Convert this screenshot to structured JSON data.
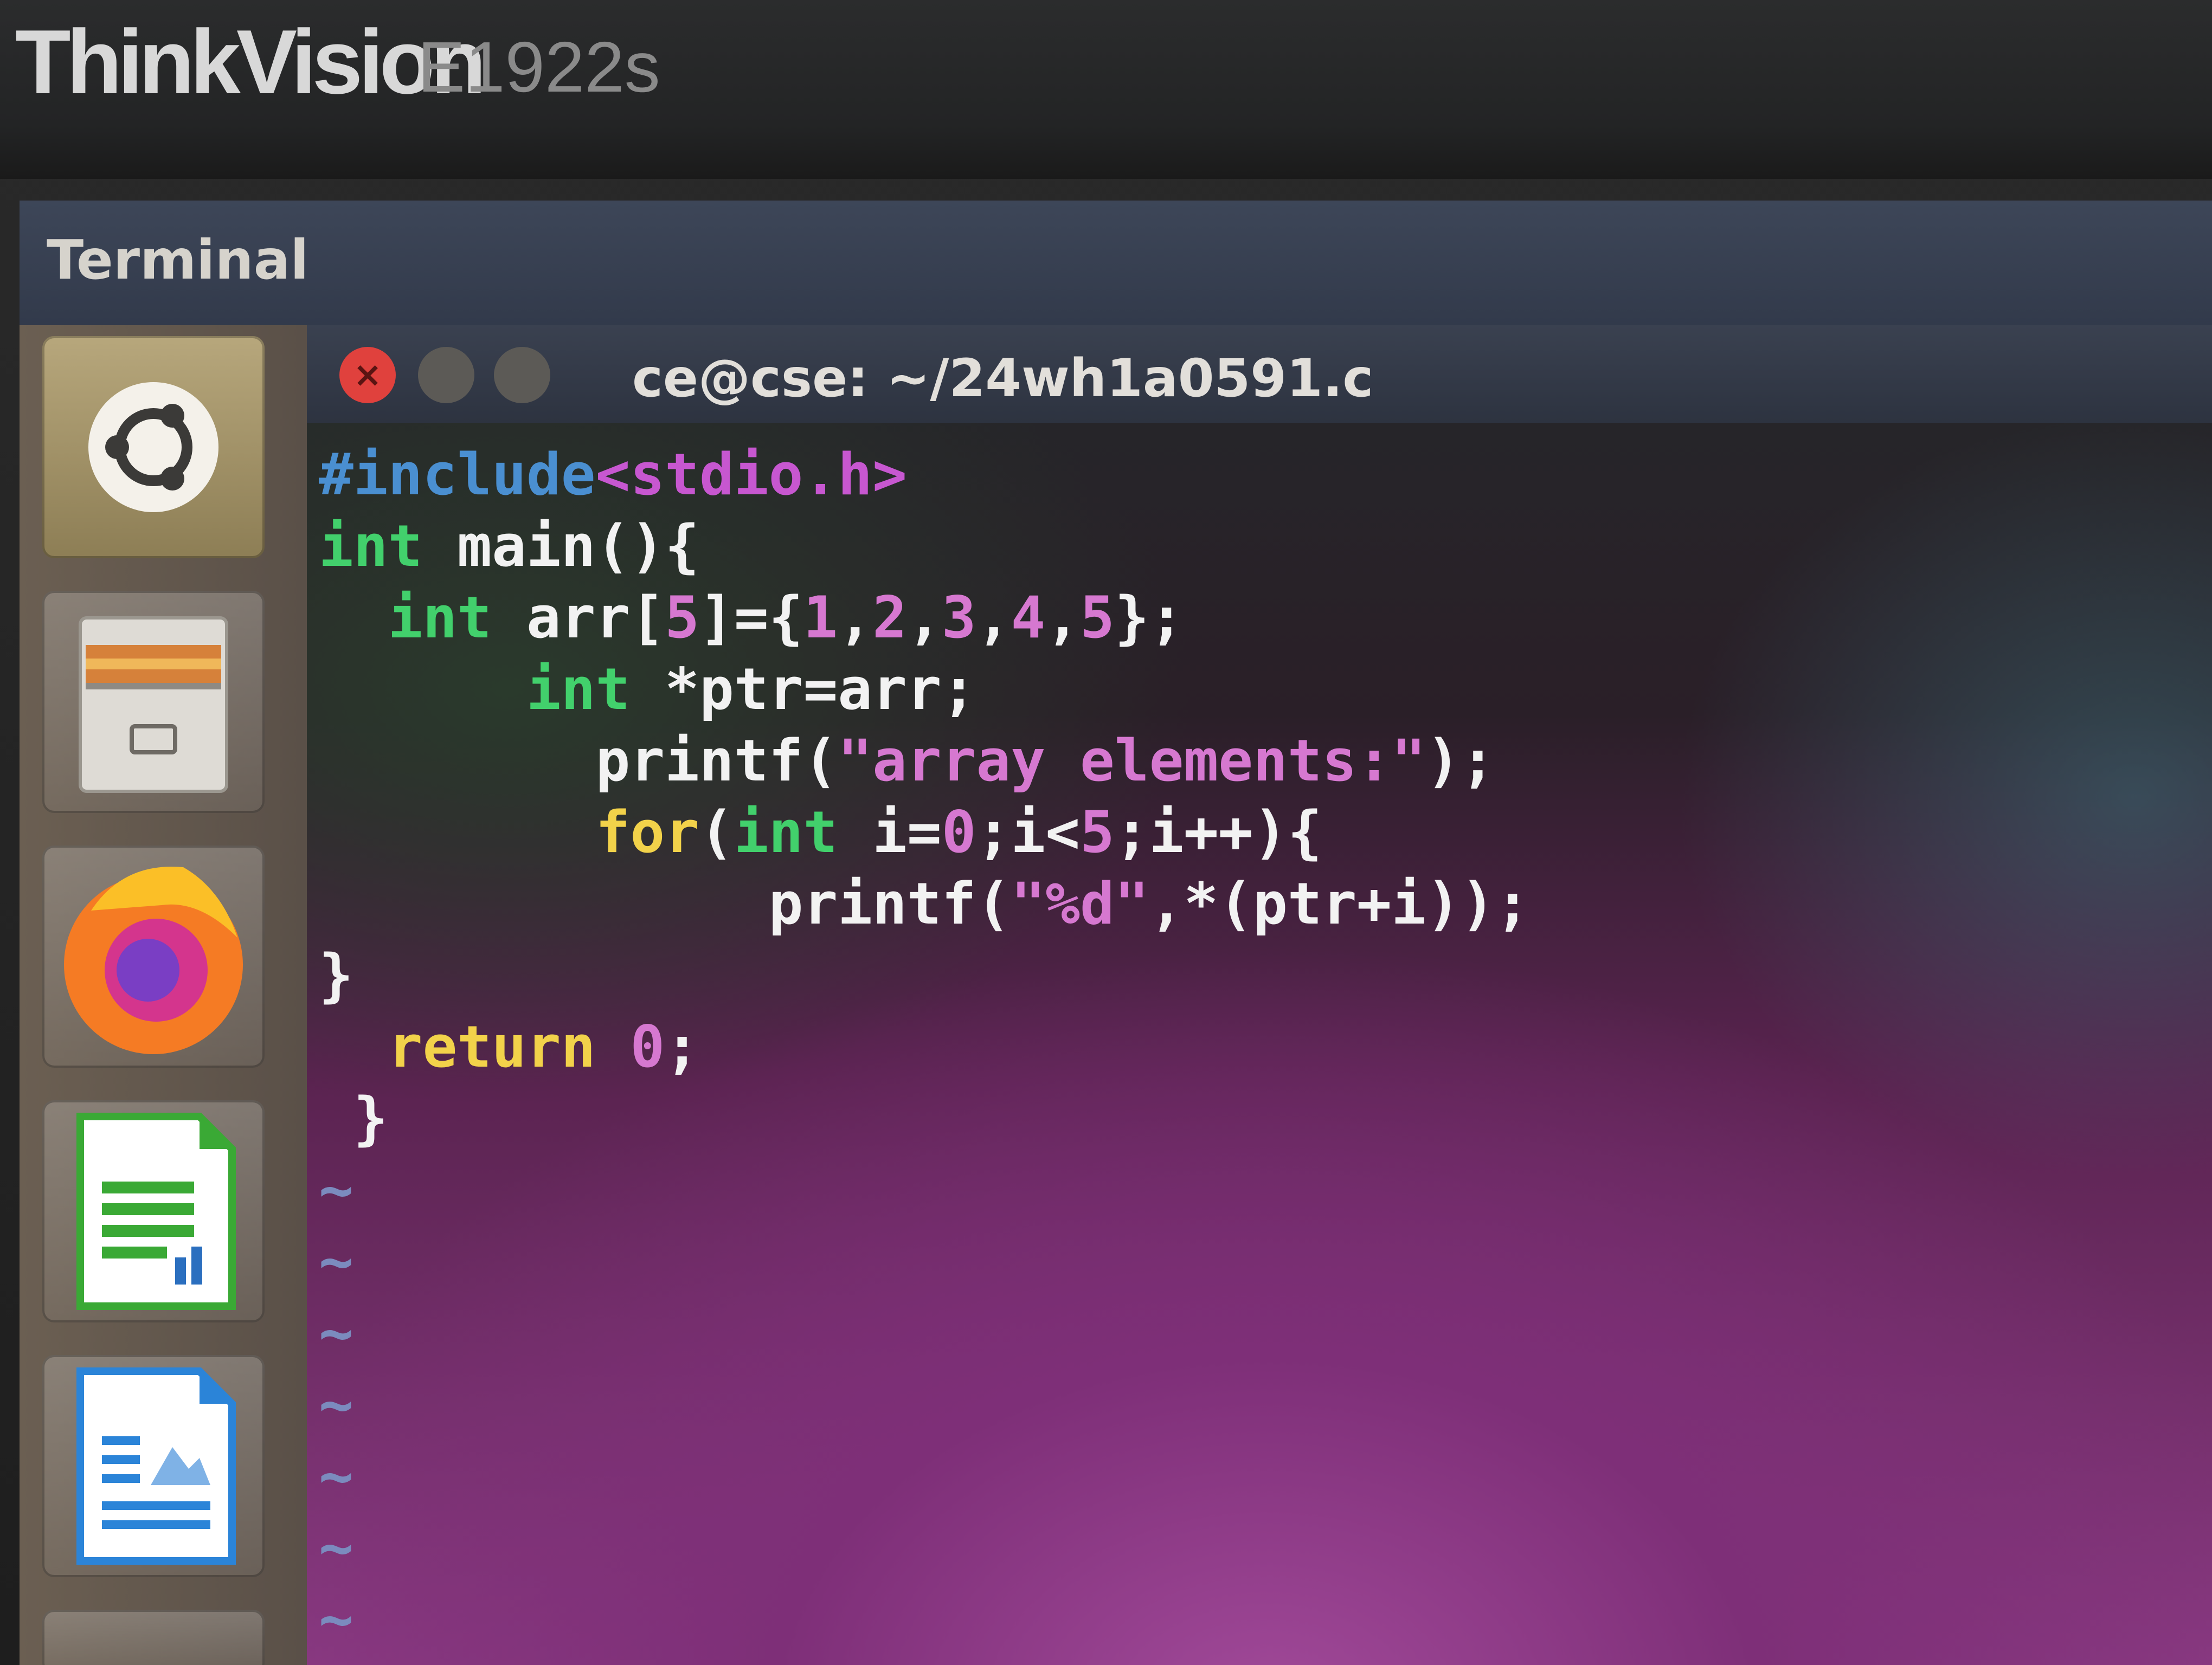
{
  "bezel": {
    "brand": "ThinkVision",
    "model": "E1922s"
  },
  "topbar": {
    "title": "Terminal"
  },
  "launcher": {
    "items": [
      {
        "name": "ubuntu-dash",
        "icon": "ubuntu-icon",
        "active": true
      },
      {
        "name": "files",
        "icon": "file-cabinet-icon"
      },
      {
        "name": "firefox",
        "icon": "firefox-icon"
      },
      {
        "name": "libreoffice-calc",
        "icon": "spreadsheet-icon"
      },
      {
        "name": "libreoffice-writer",
        "icon": "document-icon"
      }
    ]
  },
  "terminal": {
    "title": "ce@cse: ~/24wh1a0591.c",
    "close_label": "×",
    "code_lines": [
      [
        {
          "t": "#include",
          "c": "pre"
        },
        {
          "t": "<stdio.h>",
          "c": "inc"
        }
      ],
      [
        {
          "t": "int",
          "c": "type"
        },
        {
          "t": " main(){",
          "c": ""
        }
      ],
      [
        {
          "t": "  ",
          "c": ""
        },
        {
          "t": "int",
          "c": "type"
        },
        {
          "t": " arr[",
          "c": ""
        },
        {
          "t": "5",
          "c": "num"
        },
        {
          "t": "]={",
          "c": ""
        },
        {
          "t": "1",
          "c": "num"
        },
        {
          "t": ",",
          "c": ""
        },
        {
          "t": "2",
          "c": "num"
        },
        {
          "t": ",",
          "c": ""
        },
        {
          "t": "3",
          "c": "num"
        },
        {
          "t": ",",
          "c": ""
        },
        {
          "t": "4",
          "c": "num"
        },
        {
          "t": ",",
          "c": ""
        },
        {
          "t": "5",
          "c": "num"
        },
        {
          "t": "};",
          "c": ""
        }
      ],
      [
        {
          "t": "      ",
          "c": ""
        },
        {
          "t": "int",
          "c": "type"
        },
        {
          "t": " *ptr=arr;",
          "c": ""
        }
      ],
      [
        {
          "t": "        printf(",
          "c": ""
        },
        {
          "t": "\"array elements:\"",
          "c": "str"
        },
        {
          "t": ");",
          "c": ""
        }
      ],
      [
        {
          "t": "        ",
          "c": ""
        },
        {
          "t": "for",
          "c": "kw"
        },
        {
          "t": "(",
          "c": ""
        },
        {
          "t": "int",
          "c": "type"
        },
        {
          "t": " i=",
          "c": ""
        },
        {
          "t": "0",
          "c": "num"
        },
        {
          "t": ";i<",
          "c": ""
        },
        {
          "t": "5",
          "c": "num"
        },
        {
          "t": ";i++){",
          "c": ""
        }
      ],
      [
        {
          "t": "             printf(",
          "c": ""
        },
        {
          "t": "\"%d\"",
          "c": "str"
        },
        {
          "t": ",*(ptr+i));",
          "c": ""
        }
      ],
      [
        {
          "t": "}",
          "c": ""
        }
      ],
      [
        {
          "t": "  ",
          "c": ""
        },
        {
          "t": "return",
          "c": "kw"
        },
        {
          "t": " ",
          "c": ""
        },
        {
          "t": "0",
          "c": "num"
        },
        {
          "t": ";",
          "c": ""
        }
      ],
      [
        {
          "t": " }",
          "c": ""
        }
      ],
      [
        {
          "t": "~",
          "c": "tilde"
        }
      ],
      [
        {
          "t": "~",
          "c": "tilde"
        }
      ],
      [
        {
          "t": "~",
          "c": "tilde"
        }
      ],
      [
        {
          "t": "~",
          "c": "tilde"
        }
      ],
      [
        {
          "t": "~",
          "c": "tilde"
        }
      ],
      [
        {
          "t": "~",
          "c": "tilde"
        }
      ],
      [
        {
          "t": "~",
          "c": "tilde"
        }
      ]
    ]
  },
  "colors": {
    "preprocessor": "#4a8fd1",
    "include_path": "#c757d0",
    "type": "#42d06c",
    "keyword": "#f2d24a",
    "string_number": "#d678d0",
    "close_button": "#e0413d"
  }
}
